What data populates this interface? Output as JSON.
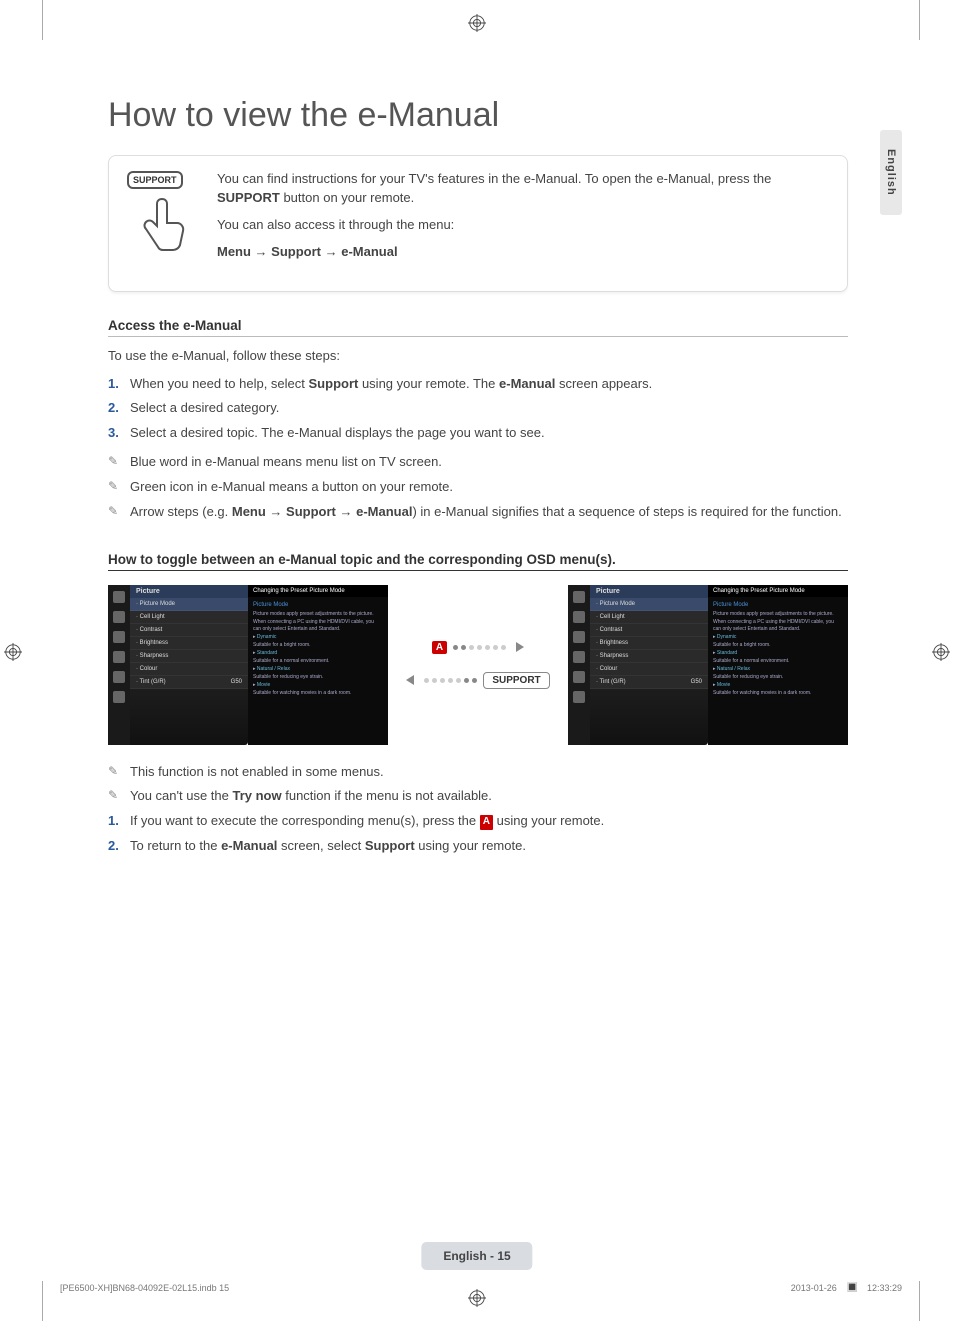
{
  "lang_tab": "English",
  "title": "How to view the e-Manual",
  "remote_button_label": "SUPPORT",
  "intro": {
    "p1a": "You can find instructions for your TV's features in the e-Manual. To open the e-Manual, press the ",
    "p1b": "SUPPORT",
    "p1c": " button on your remote.",
    "p2": "You can also access it through the menu:",
    "p3": "Menu → Support → e-Manual"
  },
  "section1_h": "Access the e-Manual",
  "section1_intro": "To use the e-Manual, follow these steps:",
  "steps1": [
    {
      "n": "1.",
      "a": "When you need to help, select ",
      "b": "Support",
      "c": " using your remote. The ",
      "d": "e-Manual",
      "e": " screen appears."
    },
    {
      "n": "2.",
      "a": "Select a desired category.",
      "b": "",
      "c": "",
      "d": "",
      "e": ""
    },
    {
      "n": "3.",
      "a": "Select a desired topic. The e-Manual displays the page you want to see.",
      "b": "",
      "c": "",
      "d": "",
      "e": ""
    }
  ],
  "notes1": [
    "Blue word in e-Manual means menu list on TV screen.",
    "Green icon in e-Manual means a button on your remote."
  ],
  "note1_arrow": {
    "pre": "Arrow steps (e.g. ",
    "bold": "Menu → Support → e-Manual",
    "post": ") in e-Manual signifies that a sequence of steps is required for the function."
  },
  "section2_h": "How to toggle between an e-Manual topic and the corresponding OSD menu(s).",
  "osd": {
    "detail_header": "Changing the Preset Picture Mode",
    "detail_sub": "Picture Mode",
    "detail_lines": [
      "Picture modes apply preset adjustments to the picture.",
      "When connecting a PC using the HDMI/DVI cable, you can only select Entertain and Standard.",
      "Dynamic",
      "Suitable for a bright room.",
      "Standard",
      "Suitable for a normal environment.",
      "Natural / Relax",
      "Suitable for reducing eye strain.",
      "Movie",
      "Suitable for watching movies in a dark room."
    ],
    "menu_header": "Picture",
    "menu_rows": [
      {
        "label": "Picture Mode",
        "val": ""
      },
      {
        "label": "Cell Light",
        "val": ""
      },
      {
        "label": "Contrast",
        "val": ""
      },
      {
        "label": "Brightness",
        "val": ""
      },
      {
        "label": "Sharpness",
        "val": ""
      },
      {
        "label": "Colour",
        "val": ""
      },
      {
        "label": "Tint (G/R)",
        "val": "G50"
      }
    ],
    "key_a": "A",
    "key_support": "SUPPORT"
  },
  "notes2": [
    "This function is not enabled in some menus."
  ],
  "note2_try": {
    "a": "You can't use the ",
    "b": "Try now",
    "c": " function if the menu is not available."
  },
  "steps2": [
    {
      "n": "1.",
      "a": "If you want to execute the corresponding menu(s), press the ",
      "b": "A",
      "c": " using your remote."
    },
    {
      "n": "2.",
      "a": "To return to the ",
      "b": "e-Manual",
      "c": " screen, select ",
      "d": "Support",
      "e": " using your remote."
    }
  ],
  "footer": {
    "chip": "English - 15",
    "left": "[PE6500-XH]BN68-04092E-02L15.indb   15",
    "date": "2013-01-26",
    "time": "12:33:29"
  }
}
